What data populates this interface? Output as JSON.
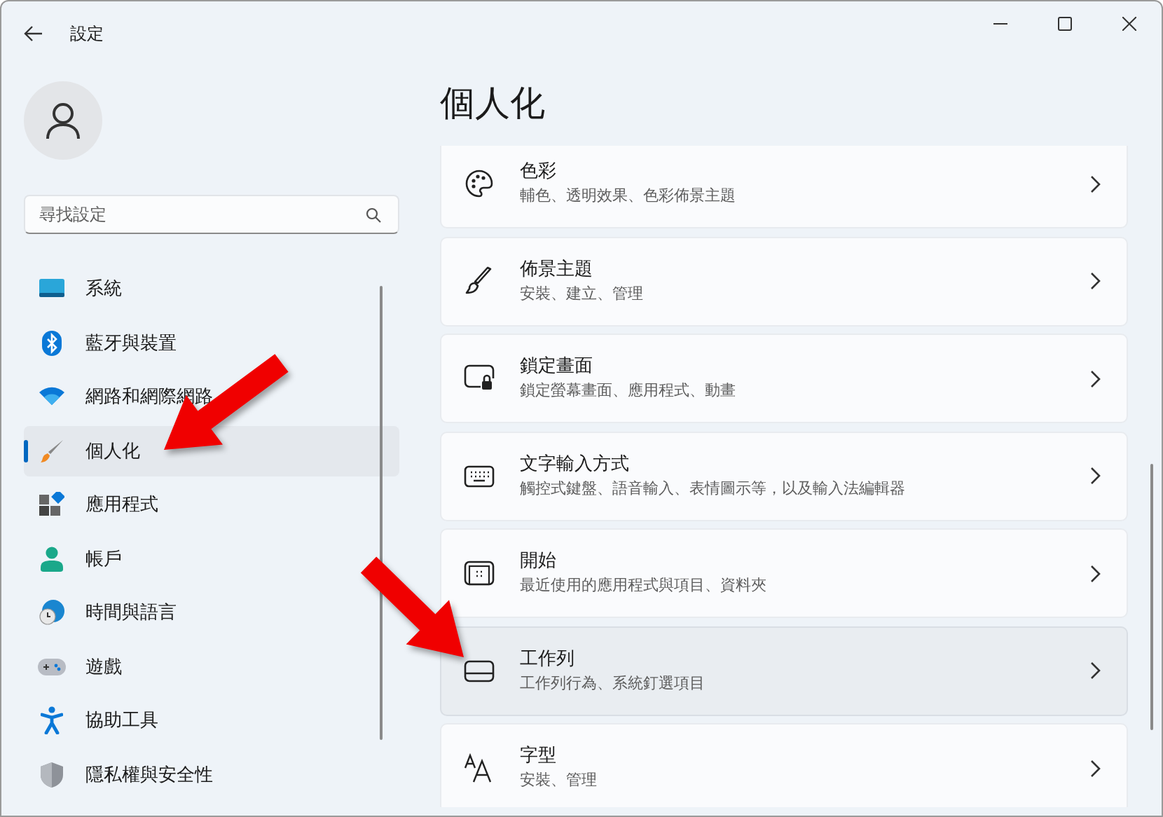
{
  "window": {
    "title": "設定"
  },
  "search": {
    "placeholder": "尋找設定"
  },
  "sidebar": {
    "items": [
      {
        "label": "系統",
        "selected": false
      },
      {
        "label": "藍牙與裝置",
        "selected": false
      },
      {
        "label": "網路和網際網路",
        "selected": false
      },
      {
        "label": "個人化",
        "selected": true
      },
      {
        "label": "應用程式",
        "selected": false
      },
      {
        "label": "帳戶",
        "selected": false
      },
      {
        "label": "時間與語言",
        "selected": false
      },
      {
        "label": "遊戲",
        "selected": false
      },
      {
        "label": "協助工具",
        "selected": false
      },
      {
        "label": "隱私權與安全性",
        "selected": false
      }
    ]
  },
  "page": {
    "title": "個人化",
    "cards": [
      {
        "title": "色彩",
        "subtitle": "輔色、透明效果、色彩佈景主題",
        "hovered": false
      },
      {
        "title": "佈景主題",
        "subtitle": "安裝、建立、管理",
        "hovered": false
      },
      {
        "title": "鎖定畫面",
        "subtitle": "鎖定螢幕畫面、應用程式、動畫",
        "hovered": false
      },
      {
        "title": "文字輸入方式",
        "subtitle": "觸控式鍵盤、語音輸入、表情圖示等，以及輸入法編輯器",
        "hovered": false
      },
      {
        "title": "開始",
        "subtitle": "最近使用的應用程式與項目、資料夾",
        "hovered": false
      },
      {
        "title": "工作列",
        "subtitle": "工作列行為、系統釘選項目",
        "hovered": true
      },
      {
        "title": "字型",
        "subtitle": "安裝、管理",
        "hovered": false
      }
    ]
  }
}
